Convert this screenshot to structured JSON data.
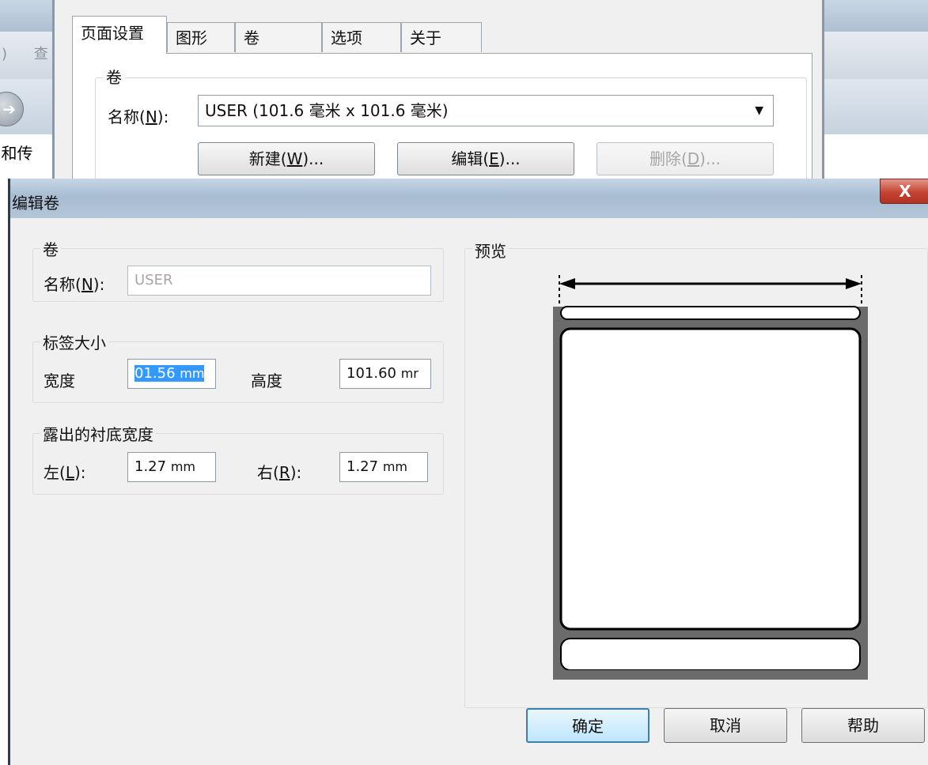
{
  "background": {
    "toolbar_text": ") 查",
    "side_text": "l和传"
  },
  "page_setup": {
    "tabs": [
      {
        "label": "页面设置",
        "active": true
      },
      {
        "label": "图形"
      },
      {
        "label": "卷"
      },
      {
        "label": "选项"
      },
      {
        "label": "关于"
      }
    ],
    "group_title": "卷",
    "name_label_text": "名称",
    "name_label_key": "N",
    "combo_value": "USER (101.6 毫米 x 101.6 毫米)",
    "buttons": {
      "new_text": "新建",
      "new_key": "W",
      "edit_text": "编辑",
      "edit_key": "E",
      "delete_text": "删除",
      "delete_key": "D",
      "ellipsis": "..."
    }
  },
  "edit_roll": {
    "title": "编辑卷",
    "close_label": "X",
    "roll_group": {
      "title": "卷",
      "name_label": "名称",
      "name_key": "N",
      "name_value": "USER"
    },
    "label_size": {
      "title": "标签大小",
      "width_label": "宽度",
      "width_value": "01.56",
      "width_unit": "mm",
      "height_label": "高度",
      "height_value": "101.60",
      "height_unit": "mr"
    },
    "liner": {
      "title": "露出的衬底宽度",
      "left_label": "左",
      "left_key": "L",
      "left_value": "1.27",
      "left_unit": "mm",
      "right_label": "右",
      "right_key": "R",
      "right_value": "1.27",
      "right_unit": "mm"
    },
    "preview_title": "预览",
    "buttons": {
      "ok": "确定",
      "cancel": "取消",
      "help": "帮助"
    }
  }
}
